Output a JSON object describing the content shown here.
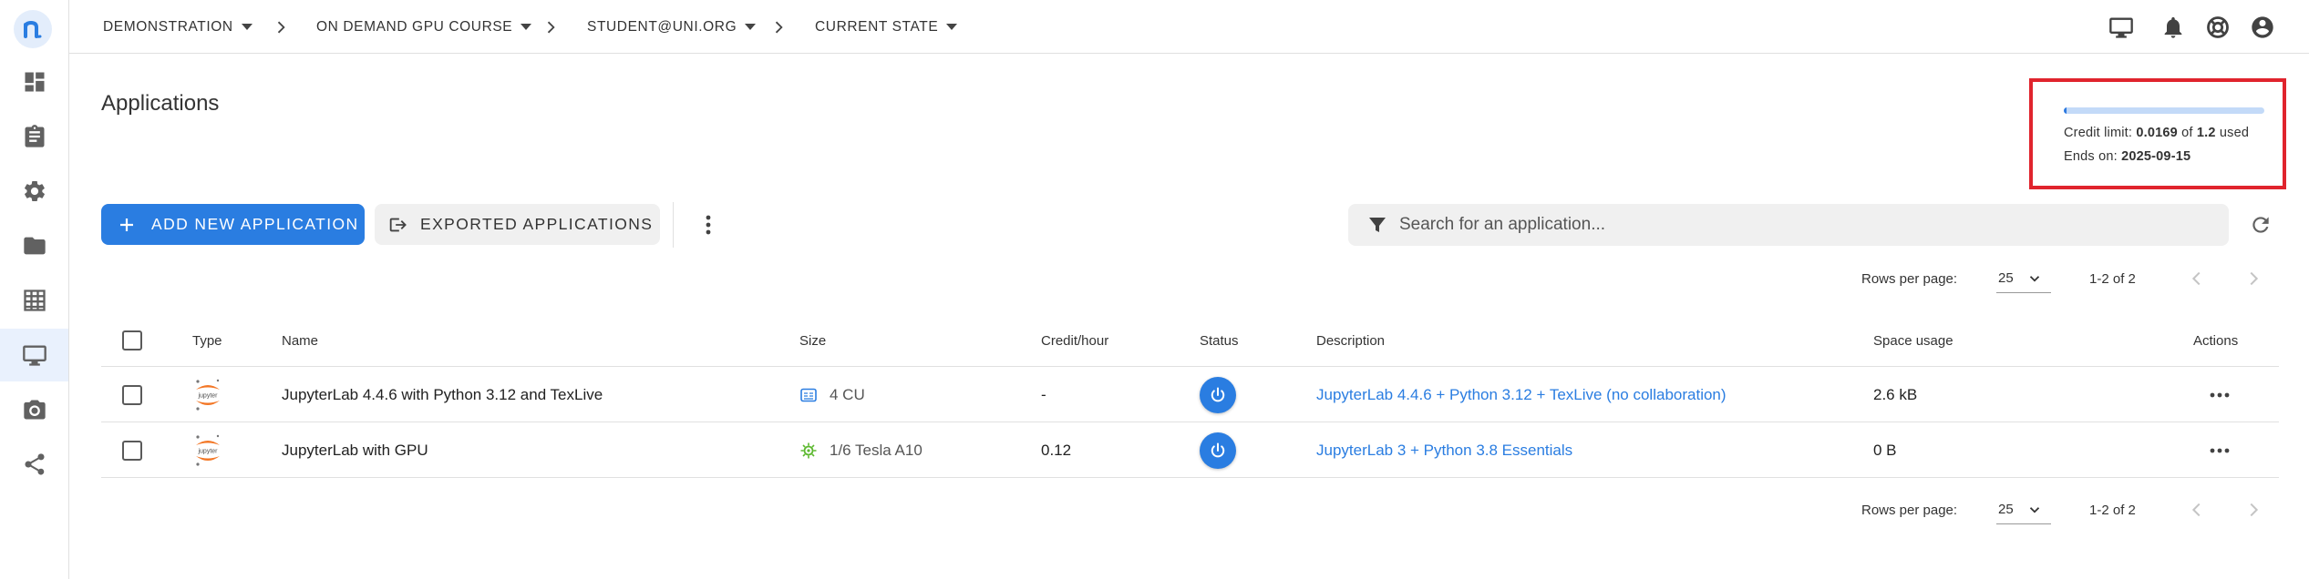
{
  "colors": {
    "accent": "#2a7de1",
    "highlight_border": "#e0242d",
    "gpu_icon": "#5cb82f"
  },
  "breadcrumb": [
    {
      "label": "DEMONSTRATION"
    },
    {
      "label": "ON DEMAND GPU COURSE"
    },
    {
      "label": "STUDENT@UNI.ORG"
    },
    {
      "label": "CURRENT STATE"
    }
  ],
  "sidebar": {
    "logo": "n",
    "items": [
      {
        "icon": "dashboard-icon"
      },
      {
        "icon": "clipboard-icon"
      },
      {
        "icon": "gear-icon"
      },
      {
        "icon": "folder-icon"
      },
      {
        "icon": "table-icon"
      },
      {
        "icon": "monitor-icon",
        "active": true
      },
      {
        "icon": "camera-icon"
      },
      {
        "icon": "share-icon"
      }
    ]
  },
  "topbar_icons": [
    "monitor-icon",
    "bell-icon",
    "help-icon",
    "account-icon"
  ],
  "page": {
    "title": "Applications"
  },
  "credit": {
    "label": "Credit limit:",
    "used": "0.0169",
    "of": "of",
    "limit": "1.2",
    "suffix": "used",
    "ends_label": "Ends on:",
    "ends_date": "2025-09-15",
    "used_fraction": 0.014
  },
  "toolbar": {
    "add_label": "ADD NEW APPLICATION",
    "exported_label": "EXPORTED APPLICATIONS"
  },
  "search": {
    "placeholder": "Search for an application..."
  },
  "pagination": {
    "rows_label": "Rows per page:",
    "rows_value": "25",
    "range": "1-2 of 2"
  },
  "table": {
    "columns": [
      "Type",
      "Name",
      "Size",
      "Credit/hour",
      "Status",
      "Description",
      "Space usage",
      "Actions"
    ],
    "type_logo_text": "jupyter",
    "rows": [
      {
        "name": "JupyterLab 4.4.6 with Python 3.12 and TexLive",
        "size_icon": "cpu-icon",
        "size": "4 CU",
        "credit_hour": "-",
        "description": "JupyterLab 4.4.6 + Python 3.12 + TexLive (no collaboration)",
        "space": "2.6 kB"
      },
      {
        "name": "JupyterLab with GPU",
        "size_icon": "gpu-icon",
        "size": "1/6 Tesla A10",
        "credit_hour": "0.12",
        "description": "JupyterLab 3 + Python 3.8 Essentials",
        "space": "0 B"
      }
    ]
  }
}
